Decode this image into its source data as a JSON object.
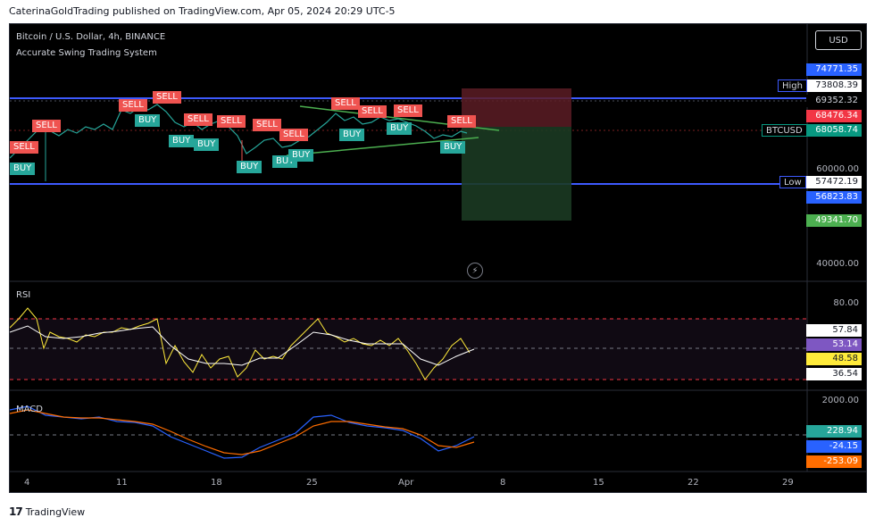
{
  "publisher": "CaterinaGoldTrading published on TradingView.com, Apr 05, 2024 20:29 UTC-5",
  "symbol_line": "Bitcoin / U.S. Dollar, 4h, BINANCE",
  "indicator_name": "Accurate Swing Trading System",
  "currency_button": "USD",
  "price_labels": [
    {
      "text": "74771.35",
      "bg": "#2962ff",
      "color": "#ffffff"
    },
    {
      "text": "73808.39",
      "bg": "#ffffff",
      "color": "#131722"
    },
    {
      "text": "69352.32",
      "bg": "#000000",
      "color": "#d1d4dc"
    },
    {
      "text": "68476.34",
      "bg": "#f23645",
      "color": "#ffffff"
    },
    {
      "text": "68058.74",
      "bg": "#089981",
      "color": "#ffffff"
    },
    {
      "text": "57472.19",
      "bg": "#ffffff",
      "color": "#131722"
    },
    {
      "text": "56823.83",
      "bg": "#2962ff",
      "color": "#ffffff"
    },
    {
      "text": "49341.70",
      "bg": "#4caf50",
      "color": "#ffffff"
    }
  ],
  "price_axis": [
    "60000.00",
    "40000.00"
  ],
  "high_tag": "High",
  "low_tag": "Low",
  "symbol_tag": "BTCUSD",
  "rsi_label": "RSI",
  "rsi_axis": "80.00",
  "rsi_values": [
    {
      "text": "57.84",
      "bg": "#ffffff",
      "color": "#131722"
    },
    {
      "text": "53.14",
      "bg": "#7e57c2",
      "color": "#ffffff"
    },
    {
      "text": "48.58",
      "bg": "#ffeb3b",
      "color": "#131722"
    },
    {
      "text": "36.54",
      "bg": "#ffffff",
      "color": "#131722"
    }
  ],
  "macd_label": "MACD",
  "macd_axis": "2000.00",
  "macd_values": [
    {
      "text": "228.94",
      "bg": "#26a69a",
      "color": "#ffffff"
    },
    {
      "text": "-24.15",
      "bg": "#2962ff",
      "color": "#ffffff"
    },
    {
      "text": "-253.09",
      "bg": "#ff6d00",
      "color": "#ffffff"
    }
  ],
  "x_axis": [
    "4",
    "11",
    "18",
    "25",
    "Apr",
    "8",
    "15",
    "22",
    "29"
  ],
  "signals": {
    "sell": "SELL",
    "buy": "BUY"
  },
  "footer_brand": "TradingView",
  "colors": {
    "bull": "#26a69a",
    "bear": "#ef5350",
    "hline": "#3d5afe",
    "trend": "#4caf50"
  }
}
